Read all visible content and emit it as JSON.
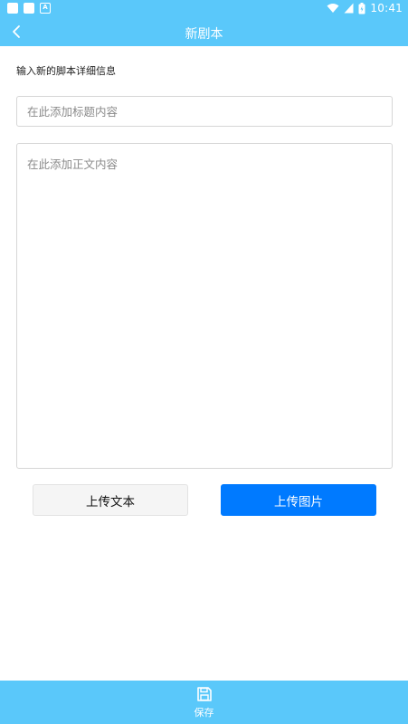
{
  "status_bar": {
    "time": "10:41",
    "notif_letter": "A"
  },
  "app_bar": {
    "title": "新剧本",
    "back_icon": "chevron-left-icon"
  },
  "form": {
    "hint": "输入新的脚本详细信息",
    "title_placeholder": "在此添加标题内容",
    "content_placeholder": "在此添加正文内容"
  },
  "actions": {
    "upload_text": "上传文本",
    "upload_image": "上传图片"
  },
  "bottom_bar": {
    "save_label": "保存",
    "save_icon": "floppy-disk-icon"
  },
  "colors": {
    "primary": "#5ac8fa",
    "accent": "#007aff",
    "secondary_button": "#f5f5f5"
  }
}
